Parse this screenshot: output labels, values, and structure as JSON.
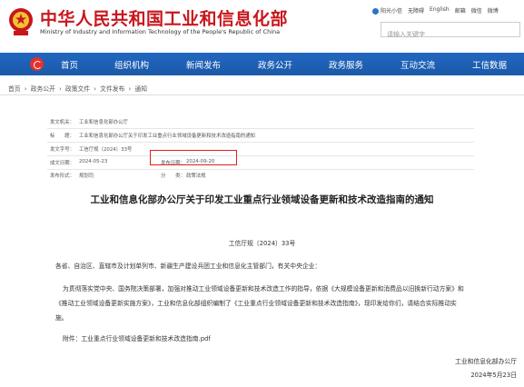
{
  "header": {
    "title": "中华人民共和国工业和信息化部",
    "subtitle": "Ministry of Industry and Information Technology of the People's Republic of China",
    "quick_links": [
      "阳光小信",
      "无障碍",
      "English",
      "邮箱",
      "微信",
      "微博"
    ],
    "search_placeholder": "请输入关键字"
  },
  "nav": {
    "items": [
      "首页",
      "组织机构",
      "新闻发布",
      "政务公开",
      "政务服务",
      "互动交流",
      "工信数据"
    ]
  },
  "breadcrumb": [
    "首页",
    "›",
    "政务公开",
    "›",
    "政策文件",
    "›",
    "文件发布",
    "›",
    "通知"
  ],
  "meta": {
    "issuer_label": "发文机关：",
    "issuer": "工业和信息化部办公厅",
    "subject_label": "标　　题：",
    "subject": "工业和信息化部办公厅关于印发工业重点行业领域设备更新和技术改造指南的通知",
    "doc_no_label": "发文字号：",
    "doc_no": "工信厅规〔2024〕33号",
    "date_label": "成文日期：",
    "date": "2024-05-23",
    "publish_label": "发布日期：",
    "publish_date": "2024-09-20",
    "form_label": "发布形式：",
    "form": "规划司",
    "category_label": "分　　类：",
    "category": "政策法规"
  },
  "document": {
    "title": "工业和信息化部办公厅关于印发工业重点行业领域设备更新和技术改造指南的通知",
    "number": "工信厅规〔2024〕33号",
    "addressee": "各省、自治区、直辖市及计划单列市、新疆生产建设兵团工业和信息化主管部门，有关中央企业：",
    "body_line1": "为贯彻落实党中央、国务院决策部署，加强对推动工业领域设备更新和技术改造工作的指导，依据《大规模设备更新和消费品以旧换新行动方案》和",
    "body_line2": "《推动工业领域设备更新实施方案》，工业和信息化部组织编制了《工业重点行业领域设备更新和技术改造指南》，现印发给你们，请结合实际推动实",
    "body_line3": "施。",
    "attachment": "附件：工业重点行业领域设备更新和技术改造指南.pdf",
    "signature_org": "工业和信息化部办公厅",
    "signature_date": "2024年5月23日"
  }
}
